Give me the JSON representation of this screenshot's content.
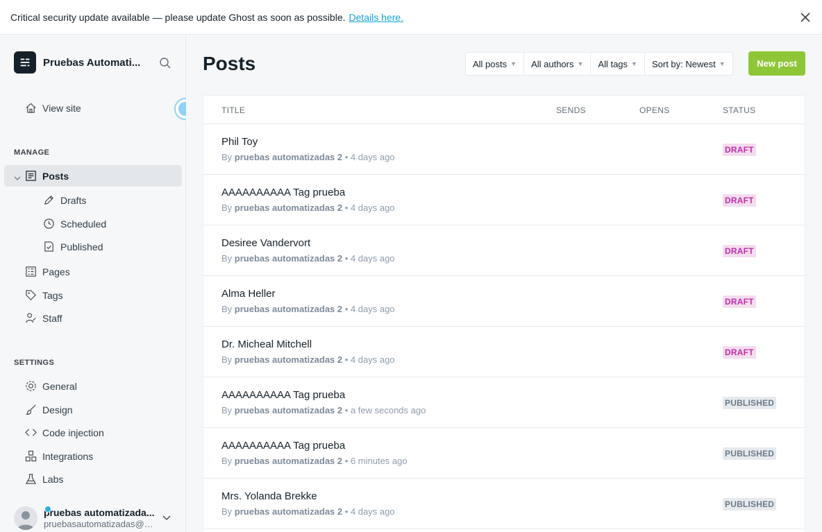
{
  "banner": {
    "message": "Critical security update available — please update Ghost as soon as possible.",
    "link": "Details here."
  },
  "sidebar": {
    "site_name": "Pruebas Automati...",
    "view_site": "View site",
    "manage_label": "MANAGE",
    "posts": "Posts",
    "drafts": "Drafts",
    "scheduled": "Scheduled",
    "published": "Published",
    "pages": "Pages",
    "tags": "Tags",
    "staff": "Staff",
    "settings_label": "SETTINGS",
    "general": "General",
    "design": "Design",
    "code_injection": "Code injection",
    "integrations": "Integrations",
    "labs": "Labs",
    "user_name": "pruebas automatizada...",
    "user_email": "pruebasautomatizadas@u..."
  },
  "header": {
    "title": "Posts",
    "filter_type": "All posts",
    "filter_author": "All authors",
    "filter_tag": "All tags",
    "sort": "Sort by: Newest",
    "new_post": "New post"
  },
  "table": {
    "col_title": "TITLE",
    "col_sends": "SENDS",
    "col_opens": "OPENS",
    "col_status": "STATUS"
  },
  "posts": [
    {
      "title": "Phil Toy",
      "author": "pruebas automatizadas 2",
      "time": "4 days ago",
      "status": "DRAFT"
    },
    {
      "title": "AAAAAAAAAA Tag prueba",
      "author": "pruebas automatizadas 2",
      "time": "4 days ago",
      "status": "DRAFT"
    },
    {
      "title": "Desiree Vandervort",
      "author": "pruebas automatizadas 2",
      "time": "4 days ago",
      "status": "DRAFT"
    },
    {
      "title": "Alma Heller",
      "author": "pruebas automatizadas 2",
      "time": "4 days ago",
      "status": "DRAFT"
    },
    {
      "title": "Dr. Micheal Mitchell",
      "author": "pruebas automatizadas 2",
      "time": "4 days ago",
      "status": "DRAFT"
    },
    {
      "title": "AAAAAAAAAA Tag prueba",
      "author": "pruebas automatizadas 2",
      "time": "a few seconds ago",
      "status": "PUBLISHED"
    },
    {
      "title": "AAAAAAAAAA Tag prueba",
      "author": "pruebas automatizadas 2",
      "time": "6 minutes ago",
      "status": "PUBLISHED"
    },
    {
      "title": "Mrs. Yolanda Brekke",
      "author": "pruebas automatizadas 2",
      "time": "4 days ago",
      "status": "PUBLISHED"
    }
  ],
  "meta_by": "By",
  "meta_sep": "•",
  "colors": {
    "accent_green": "#8fc637",
    "draft_bg": "#f5dcef",
    "draft_text": "#c22ea6",
    "published_bg": "#e6eaee",
    "published_text": "#6b7a88",
    "link": "#14a3d8"
  }
}
